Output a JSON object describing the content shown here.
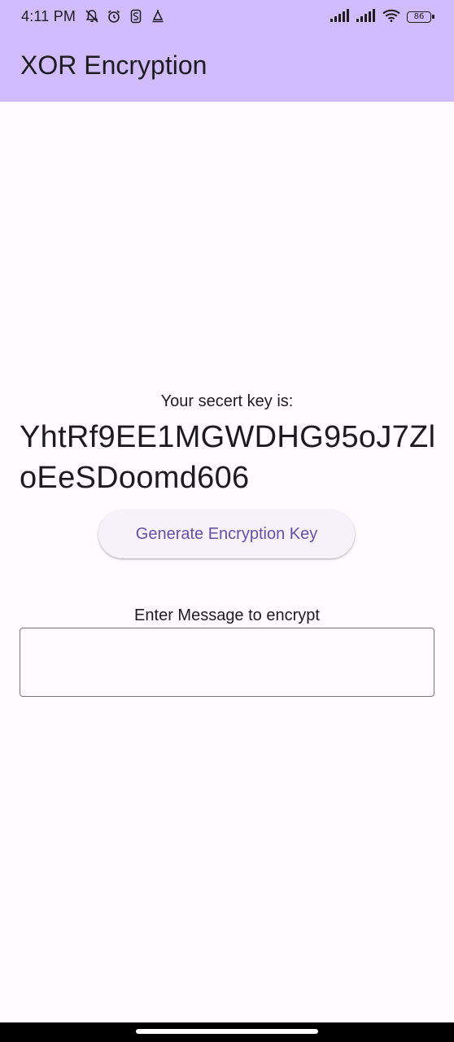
{
  "status_bar": {
    "time": "4:11 PM",
    "battery_level": "86",
    "left_icons": [
      "notifications-muted-icon",
      "alarm-icon",
      "sim-icon",
      "bell-icon"
    ],
    "right_icons": [
      "signal-icon",
      "signal-icon",
      "wifi-icon",
      "battery-icon"
    ]
  },
  "app_bar": {
    "title": "XOR Encryption"
  },
  "key_section": {
    "caption": "Your secert key is:",
    "key_value": "YhtRf9EE1MGWDHG95oJ7ZloEeSDoomd606",
    "generate_button_label": "Generate Encryption Key"
  },
  "message_section": {
    "label": "Enter Message to encrypt",
    "input_value": ""
  },
  "colors": {
    "app_bar_background": "#d0bcff",
    "page_background": "#fffbfe",
    "button_text": "#6750a4",
    "button_background": "#f7f2fa",
    "input_border": "#79747e"
  }
}
